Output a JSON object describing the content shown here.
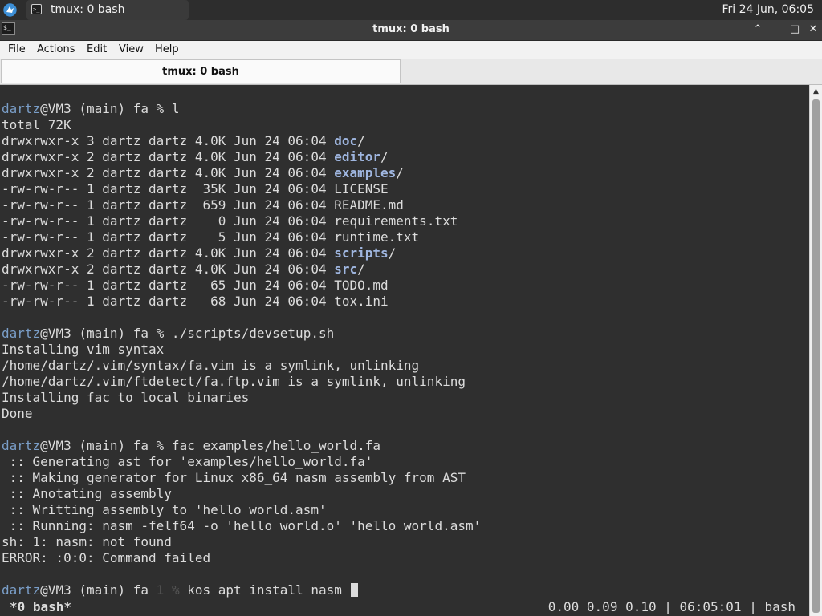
{
  "panel": {
    "task_label": "tmux: 0 bash",
    "clock": "Fri 24 Jun, 06:05"
  },
  "window": {
    "title": "tmux: 0 bash",
    "controls": {
      "shade": "⌃",
      "minimize": "_",
      "maximize": "□",
      "close": "✕"
    }
  },
  "menu": {
    "file": "File",
    "actions": "Actions",
    "edit": "Edit",
    "view": "View",
    "help": "Help"
  },
  "tab": {
    "label": "tmux: 0 bash"
  },
  "terminal": {
    "prompt_user": "dartz",
    "lines": {
      "l1_rest": "@VM3 (main) fa % l",
      "l2": "total 72K",
      "ls": [
        {
          "meta": "drwxrwxr-x 3 dartz dartz 4.0K Jun 24 06:04 ",
          "name": "doc",
          "suffix": "/",
          "dir": true
        },
        {
          "meta": "drwxrwxr-x 2 dartz dartz 4.0K Jun 24 06:04 ",
          "name": "editor",
          "suffix": "/",
          "dir": true
        },
        {
          "meta": "drwxrwxr-x 2 dartz dartz 4.0K Jun 24 06:04 ",
          "name": "examples",
          "suffix": "/",
          "dir": true
        },
        {
          "meta": "-rw-rw-r-- 1 dartz dartz  35K Jun 24 06:04 ",
          "name": "LICENSE",
          "suffix": "",
          "dir": false
        },
        {
          "meta": "-rw-rw-r-- 1 dartz dartz  659 Jun 24 06:04 ",
          "name": "README.md",
          "suffix": "",
          "dir": false
        },
        {
          "meta": "-rw-rw-r-- 1 dartz dartz    0 Jun 24 06:04 ",
          "name": "requirements.txt",
          "suffix": "",
          "dir": false
        },
        {
          "meta": "-rw-rw-r-- 1 dartz dartz    5 Jun 24 06:04 ",
          "name": "runtime.txt",
          "suffix": "",
          "dir": false
        },
        {
          "meta": "drwxrwxr-x 2 dartz dartz 4.0K Jun 24 06:04 ",
          "name": "scripts",
          "suffix": "/",
          "dir": true
        },
        {
          "meta": "drwxrwxr-x 2 dartz dartz 4.0K Jun 24 06:04 ",
          "name": "src",
          "suffix": "/",
          "dir": true
        },
        {
          "meta": "-rw-rw-r-- 1 dartz dartz   65 Jun 24 06:04 ",
          "name": "TODO.md",
          "suffix": "",
          "dir": false
        },
        {
          "meta": "-rw-rw-r-- 1 dartz dartz   68 Jun 24 06:04 ",
          "name": "tox.ini",
          "suffix": "",
          "dir": false
        }
      ],
      "devsetup_cmd_rest": "@VM3 (main) fa % ./scripts/devsetup.sh",
      "devsetup_out": [
        "Installing vim syntax",
        "/home/dartz/.vim/syntax/fa.vim is a symlink, unlinking",
        "/home/dartz/.vim/ftdetect/fa.ftp.vim is a symlink, unlinking",
        "Installing fac to local binaries",
        "Done"
      ],
      "fac_cmd_rest": "@VM3 (main) fa % fac examples/hello_world.fa",
      "fac_out": [
        " :: Generating ast for 'examples/hello_world.fa'",
        " :: Making generator for Linux x86_64 nasm assembly from AST",
        " :: Anotating assembly",
        " :: Writting assembly to 'hello_world.asm'",
        " :: Running: nasm -felf64 -o 'hello_world.o' 'hello_world.asm'",
        "sh: 1: nasm: not found",
        "ERROR: :0:0: Command failed"
      ],
      "last_prompt_a": "@VM3 (main) fa ",
      "last_prompt_code": "1 %",
      "last_cmd": " kos apt install nasm "
    }
  },
  "status": {
    "left": "*0 bash*",
    "right": "0.00 0.09 0.10 | 06:05:01 | bash"
  }
}
